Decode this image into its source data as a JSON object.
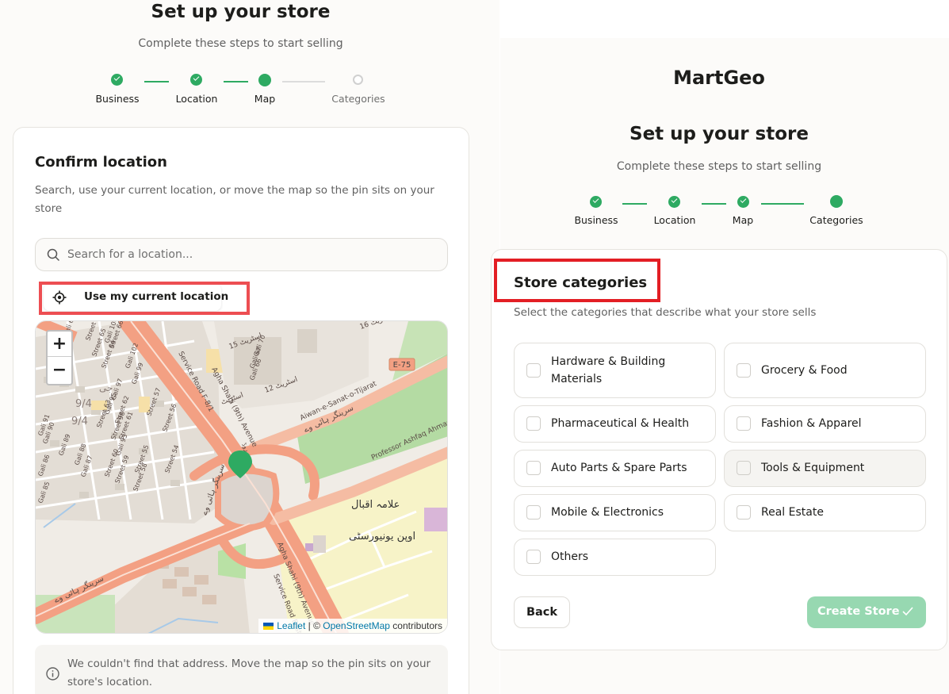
{
  "left": {
    "title": "Set up your store",
    "subtitle": "Complete these steps to start selling",
    "steps": [
      {
        "label": "Business",
        "state": "done"
      },
      {
        "label": "Location",
        "state": "done"
      },
      {
        "label": "Map",
        "state": "current"
      },
      {
        "label": "Categories",
        "state": "todo"
      }
    ],
    "card": {
      "title": "Confirm location",
      "description": "Search, use your current location, or move the map so the pin sits on your store",
      "search_placeholder": "Search for a location...",
      "current_location_label": "Use my current location",
      "map": {
        "zoom_in": "+",
        "zoom_out": "−",
        "attribution": {
          "leaflet": "Leaflet",
          "separator": " | © ",
          "osm": "OpenStreetMap",
          "suffix": " contributors"
        },
        "street_labels": {
          "avenue_1": "Agha Shahi (9th) Avenue",
          "avenue_2": "Agha Shahi (9th) Avenue",
          "road": "Aiwan-e-Sanat-o-Tijarat",
          "professor": "Professor Ashfaq Ahmad",
          "service_road_west": "Service Road F-8/1",
          "service_road_east": "Service Road East H-9",
          "highway": "E-75",
          "sector_1": "9/4",
          "sector_2": "9/4",
          "urdu_university_1": "علامہ اقبال",
          "urdu_university_2": "اوپن یونیورسٹی",
          "urdu_road_1": "سرینگر ہائی وے",
          "urdu_road_2": "سرینگر ہائی وے",
          "urdu_road_3": "سرینگر ہائی وے",
          "urdu_street_1": "اسٹریٹ 15",
          "urdu_street_2": "اسٹریٹ 12",
          "urdu_street_3": "اسٹریٹ 16",
          "urdu_street_4": "اسٹریٹ",
          "urdu_sector": "جی",
          "urdu_road_label": "روڈ",
          "gali_labels": [
            "Gali 70",
            "Gali 67",
            "Gali 66",
            "Gali 65",
            "Gali 104",
            "Gali 102",
            "Gali 99",
            "Gali 97",
            "Gali 95",
            "Gali 93",
            "Gali 91",
            "Gali 90",
            "Gali 89",
            "Gali 88",
            "Gali 87",
            "Gali 86",
            "Gali 85"
          ],
          "street_labels": [
            "Street 67",
            "Street 66",
            "Street 65",
            "Street 64",
            "Street 63",
            "Street 62",
            "Street 61",
            "Street 60",
            "Street 59",
            "Street 58",
            "Street 57",
            "Street 56",
            "Street 55",
            "Street 54",
            "Street 96"
          ]
        }
      },
      "warning": "We couldn't find that address. Move the map so the pin sits on your store's location."
    }
  },
  "right": {
    "brand": "MartGeo",
    "title": "Set up your store",
    "subtitle": "Complete these steps to start selling",
    "steps": [
      {
        "label": "Business",
        "state": "done"
      },
      {
        "label": "Location",
        "state": "done"
      },
      {
        "label": "Map",
        "state": "done"
      },
      {
        "label": "Categories",
        "state": "current"
      }
    ],
    "card": {
      "title": "Store categories",
      "description": "Select the categories that describe what your store sells",
      "categories": [
        {
          "label": "Hardware & Building Materials"
        },
        {
          "label": "Grocery & Food"
        },
        {
          "label": "Pharmaceutical & Health"
        },
        {
          "label": "Fashion & Apparel"
        },
        {
          "label": "Auto Parts & Spare Parts"
        },
        {
          "label": "Tools & Equipment"
        },
        {
          "label": "Mobile & Electronics"
        },
        {
          "label": "Real Estate"
        },
        {
          "label": "Others"
        }
      ],
      "back_label": "Back",
      "create_label": "Create Store"
    }
  },
  "colors": {
    "accent": "#2eaa62",
    "accent_disabled": "#97d8b1",
    "highlight_red": "#e31e24",
    "map_road": "#f3a083",
    "map_green": "#b4dba3"
  },
  "icons": [
    "search-icon",
    "crosshair-icon",
    "map-pin-icon",
    "info-icon",
    "check-icon"
  ]
}
